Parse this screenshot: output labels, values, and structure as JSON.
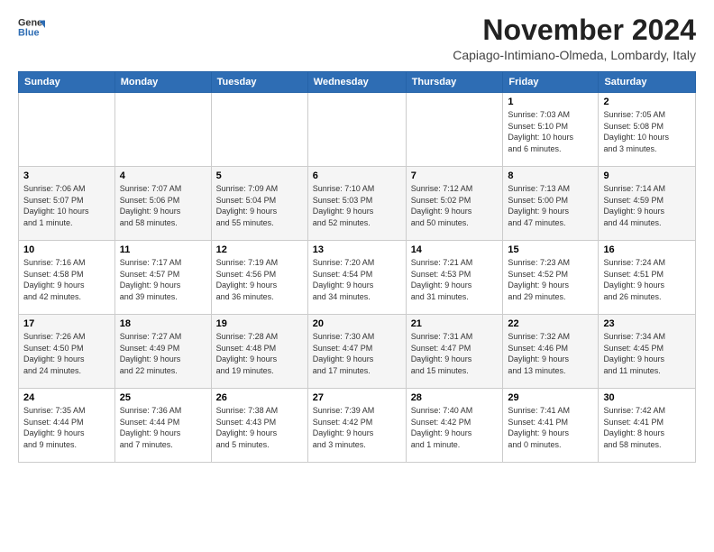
{
  "header": {
    "logo_line1": "General",
    "logo_line2": "Blue",
    "month": "November 2024",
    "location": "Capiago-Intimiano-Olmeda, Lombardy, Italy"
  },
  "weekdays": [
    "Sunday",
    "Monday",
    "Tuesday",
    "Wednesday",
    "Thursday",
    "Friday",
    "Saturday"
  ],
  "weeks": [
    [
      {
        "day": "",
        "info": ""
      },
      {
        "day": "",
        "info": ""
      },
      {
        "day": "",
        "info": ""
      },
      {
        "day": "",
        "info": ""
      },
      {
        "day": "",
        "info": ""
      },
      {
        "day": "1",
        "info": "Sunrise: 7:03 AM\nSunset: 5:10 PM\nDaylight: 10 hours\nand 6 minutes."
      },
      {
        "day": "2",
        "info": "Sunrise: 7:05 AM\nSunset: 5:08 PM\nDaylight: 10 hours\nand 3 minutes."
      }
    ],
    [
      {
        "day": "3",
        "info": "Sunrise: 7:06 AM\nSunset: 5:07 PM\nDaylight: 10 hours\nand 1 minute."
      },
      {
        "day": "4",
        "info": "Sunrise: 7:07 AM\nSunset: 5:06 PM\nDaylight: 9 hours\nand 58 minutes."
      },
      {
        "day": "5",
        "info": "Sunrise: 7:09 AM\nSunset: 5:04 PM\nDaylight: 9 hours\nand 55 minutes."
      },
      {
        "day": "6",
        "info": "Sunrise: 7:10 AM\nSunset: 5:03 PM\nDaylight: 9 hours\nand 52 minutes."
      },
      {
        "day": "7",
        "info": "Sunrise: 7:12 AM\nSunset: 5:02 PM\nDaylight: 9 hours\nand 50 minutes."
      },
      {
        "day": "8",
        "info": "Sunrise: 7:13 AM\nSunset: 5:00 PM\nDaylight: 9 hours\nand 47 minutes."
      },
      {
        "day": "9",
        "info": "Sunrise: 7:14 AM\nSunset: 4:59 PM\nDaylight: 9 hours\nand 44 minutes."
      }
    ],
    [
      {
        "day": "10",
        "info": "Sunrise: 7:16 AM\nSunset: 4:58 PM\nDaylight: 9 hours\nand 42 minutes."
      },
      {
        "day": "11",
        "info": "Sunrise: 7:17 AM\nSunset: 4:57 PM\nDaylight: 9 hours\nand 39 minutes."
      },
      {
        "day": "12",
        "info": "Sunrise: 7:19 AM\nSunset: 4:56 PM\nDaylight: 9 hours\nand 36 minutes."
      },
      {
        "day": "13",
        "info": "Sunrise: 7:20 AM\nSunset: 4:54 PM\nDaylight: 9 hours\nand 34 minutes."
      },
      {
        "day": "14",
        "info": "Sunrise: 7:21 AM\nSunset: 4:53 PM\nDaylight: 9 hours\nand 31 minutes."
      },
      {
        "day": "15",
        "info": "Sunrise: 7:23 AM\nSunset: 4:52 PM\nDaylight: 9 hours\nand 29 minutes."
      },
      {
        "day": "16",
        "info": "Sunrise: 7:24 AM\nSunset: 4:51 PM\nDaylight: 9 hours\nand 26 minutes."
      }
    ],
    [
      {
        "day": "17",
        "info": "Sunrise: 7:26 AM\nSunset: 4:50 PM\nDaylight: 9 hours\nand 24 minutes."
      },
      {
        "day": "18",
        "info": "Sunrise: 7:27 AM\nSunset: 4:49 PM\nDaylight: 9 hours\nand 22 minutes."
      },
      {
        "day": "19",
        "info": "Sunrise: 7:28 AM\nSunset: 4:48 PM\nDaylight: 9 hours\nand 19 minutes."
      },
      {
        "day": "20",
        "info": "Sunrise: 7:30 AM\nSunset: 4:47 PM\nDaylight: 9 hours\nand 17 minutes."
      },
      {
        "day": "21",
        "info": "Sunrise: 7:31 AM\nSunset: 4:47 PM\nDaylight: 9 hours\nand 15 minutes."
      },
      {
        "day": "22",
        "info": "Sunrise: 7:32 AM\nSunset: 4:46 PM\nDaylight: 9 hours\nand 13 minutes."
      },
      {
        "day": "23",
        "info": "Sunrise: 7:34 AM\nSunset: 4:45 PM\nDaylight: 9 hours\nand 11 minutes."
      }
    ],
    [
      {
        "day": "24",
        "info": "Sunrise: 7:35 AM\nSunset: 4:44 PM\nDaylight: 9 hours\nand 9 minutes."
      },
      {
        "day": "25",
        "info": "Sunrise: 7:36 AM\nSunset: 4:44 PM\nDaylight: 9 hours\nand 7 minutes."
      },
      {
        "day": "26",
        "info": "Sunrise: 7:38 AM\nSunset: 4:43 PM\nDaylight: 9 hours\nand 5 minutes."
      },
      {
        "day": "27",
        "info": "Sunrise: 7:39 AM\nSunset: 4:42 PM\nDaylight: 9 hours\nand 3 minutes."
      },
      {
        "day": "28",
        "info": "Sunrise: 7:40 AM\nSunset: 4:42 PM\nDaylight: 9 hours\nand 1 minute."
      },
      {
        "day": "29",
        "info": "Sunrise: 7:41 AM\nSunset: 4:41 PM\nDaylight: 9 hours\nand 0 minutes."
      },
      {
        "day": "30",
        "info": "Sunrise: 7:42 AM\nSunset: 4:41 PM\nDaylight: 8 hours\nand 58 minutes."
      }
    ]
  ]
}
